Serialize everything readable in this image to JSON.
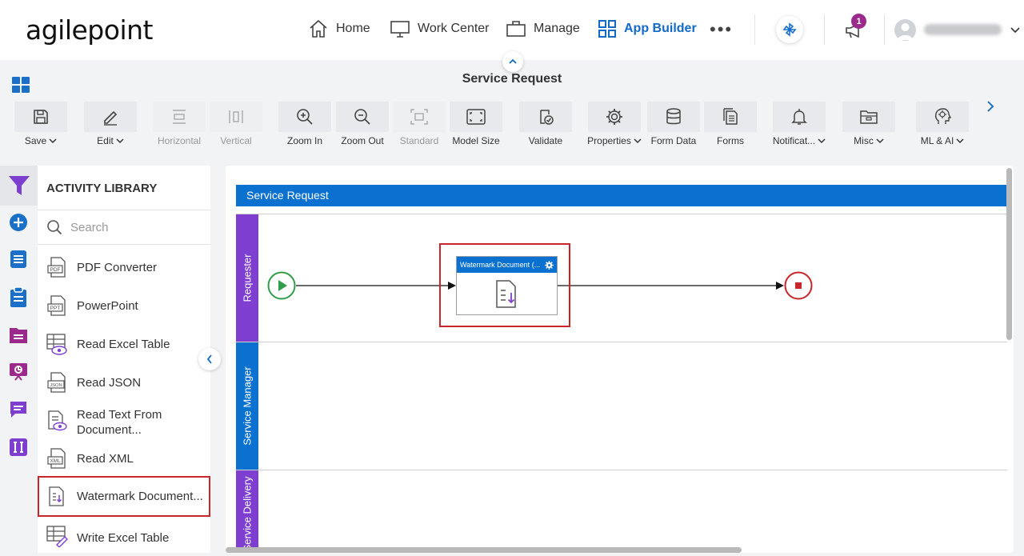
{
  "app": {
    "logo_text": "agilepoint",
    "brand_color": "#0a71d0",
    "highlight_color": "#c8262a",
    "lane_color": "#7e3fd0"
  },
  "nav": {
    "home": "Home",
    "work_center": "Work Center",
    "manage": "Manage",
    "app_builder": "App Builder",
    "more": "•••",
    "notification_count": "1"
  },
  "page": {
    "title": "Service Request"
  },
  "toolbar": {
    "save": "Save",
    "edit": "Edit",
    "horizontal": "Horizontal",
    "vertical": "Vertical",
    "zoom_in": "Zoom In",
    "zoom_out": "Zoom Out",
    "standard": "Standard",
    "model_size": "Model Size",
    "validate": "Validate",
    "properties": "Properties",
    "form_data": "Form Data",
    "forms": "Forms",
    "notifications": "Notificat...",
    "misc": "Misc",
    "ml_ai": "ML & AI"
  },
  "library": {
    "title": "ACTIVITY LIBRARY",
    "search_placeholder": "Search",
    "items": [
      {
        "label": "PDF Converter",
        "icon": "pdf-icon"
      },
      {
        "label": "PowerPoint",
        "icon": "ppt-icon"
      },
      {
        "label": "Read Excel Table",
        "icon": "read-excel-icon"
      },
      {
        "label": "Read JSON",
        "icon": "json-icon"
      },
      {
        "label": "Read Text From Document...",
        "icon": "read-text-icon"
      },
      {
        "label": "Read XML",
        "icon": "xml-icon"
      },
      {
        "label": "Watermark Document...",
        "icon": "watermark-icon"
      },
      {
        "label": "Write Excel Table",
        "icon": "write-excel-icon"
      }
    ]
  },
  "process": {
    "pool_name": "Service Request",
    "lanes": [
      "Requester",
      "Service Manager",
      "Service Delivery"
    ],
    "task_title": "Watermark Document (..."
  }
}
